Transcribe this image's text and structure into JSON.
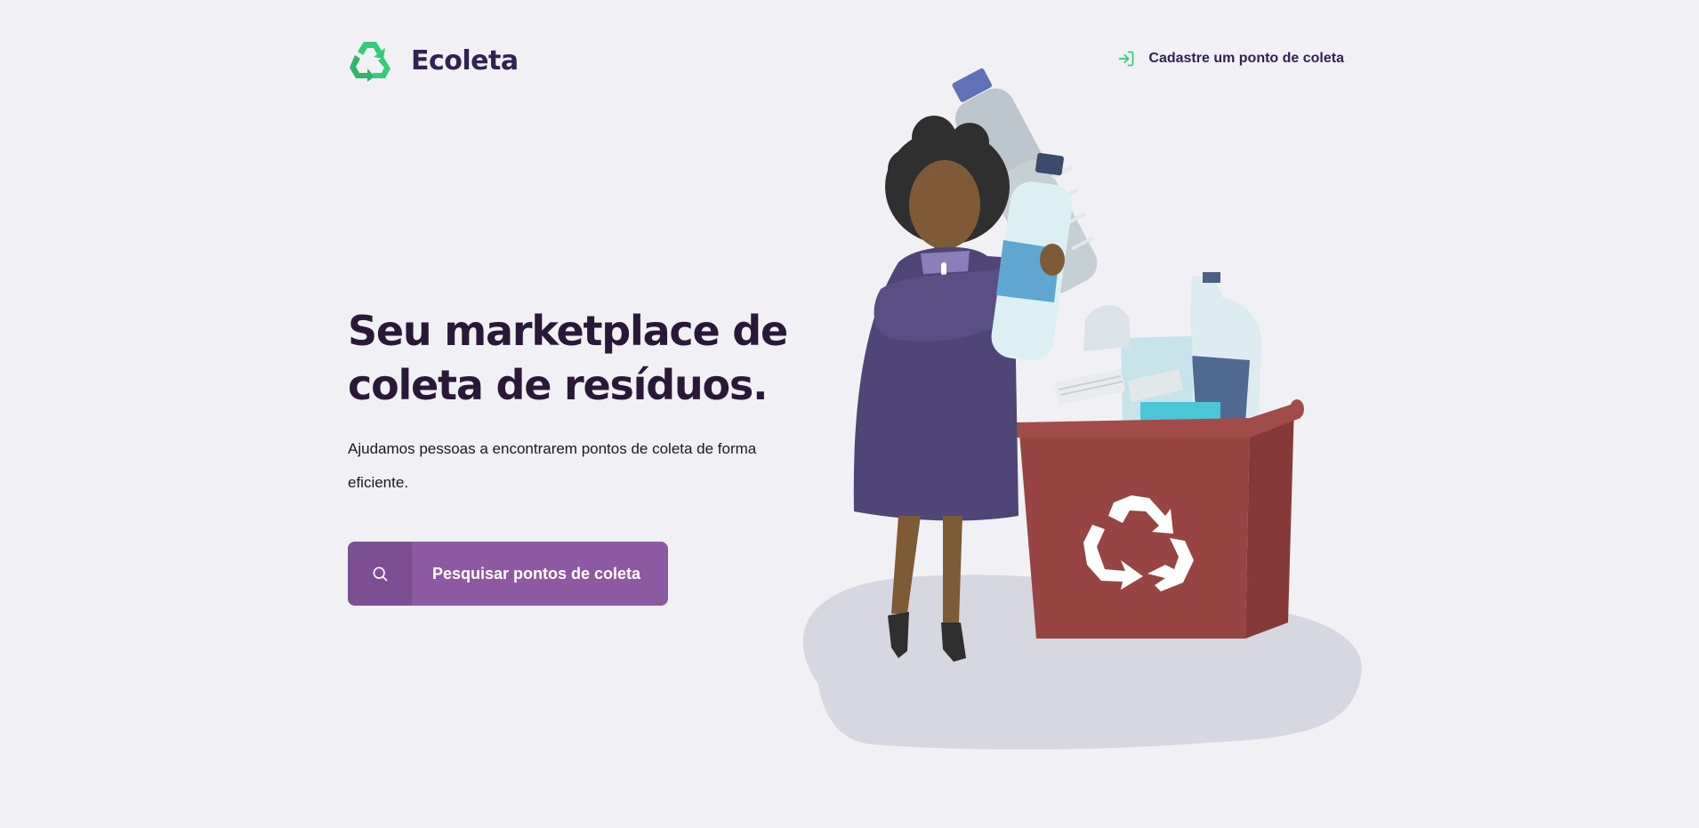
{
  "header": {
    "logo_text": "Ecoleta",
    "register_link_label": "Cadastre um ponto de coleta",
    "register_icon": "log-in-icon"
  },
  "hero": {
    "title": "Seu marketplace de coleta de resíduos.",
    "description": "Ajudamos pessoas a encontrarem pontos de coleta de forma eficiente.",
    "search_button_label": "Pesquisar pontos de coleta",
    "search_icon": "search-icon"
  },
  "colors": {
    "background": "#f0f0f5",
    "title": "#2a1838",
    "brand_green": "#34cb79",
    "button_purple": "#8b5aa0",
    "button_icon_bg": "#7b4f92",
    "bin_red": "#984442"
  }
}
